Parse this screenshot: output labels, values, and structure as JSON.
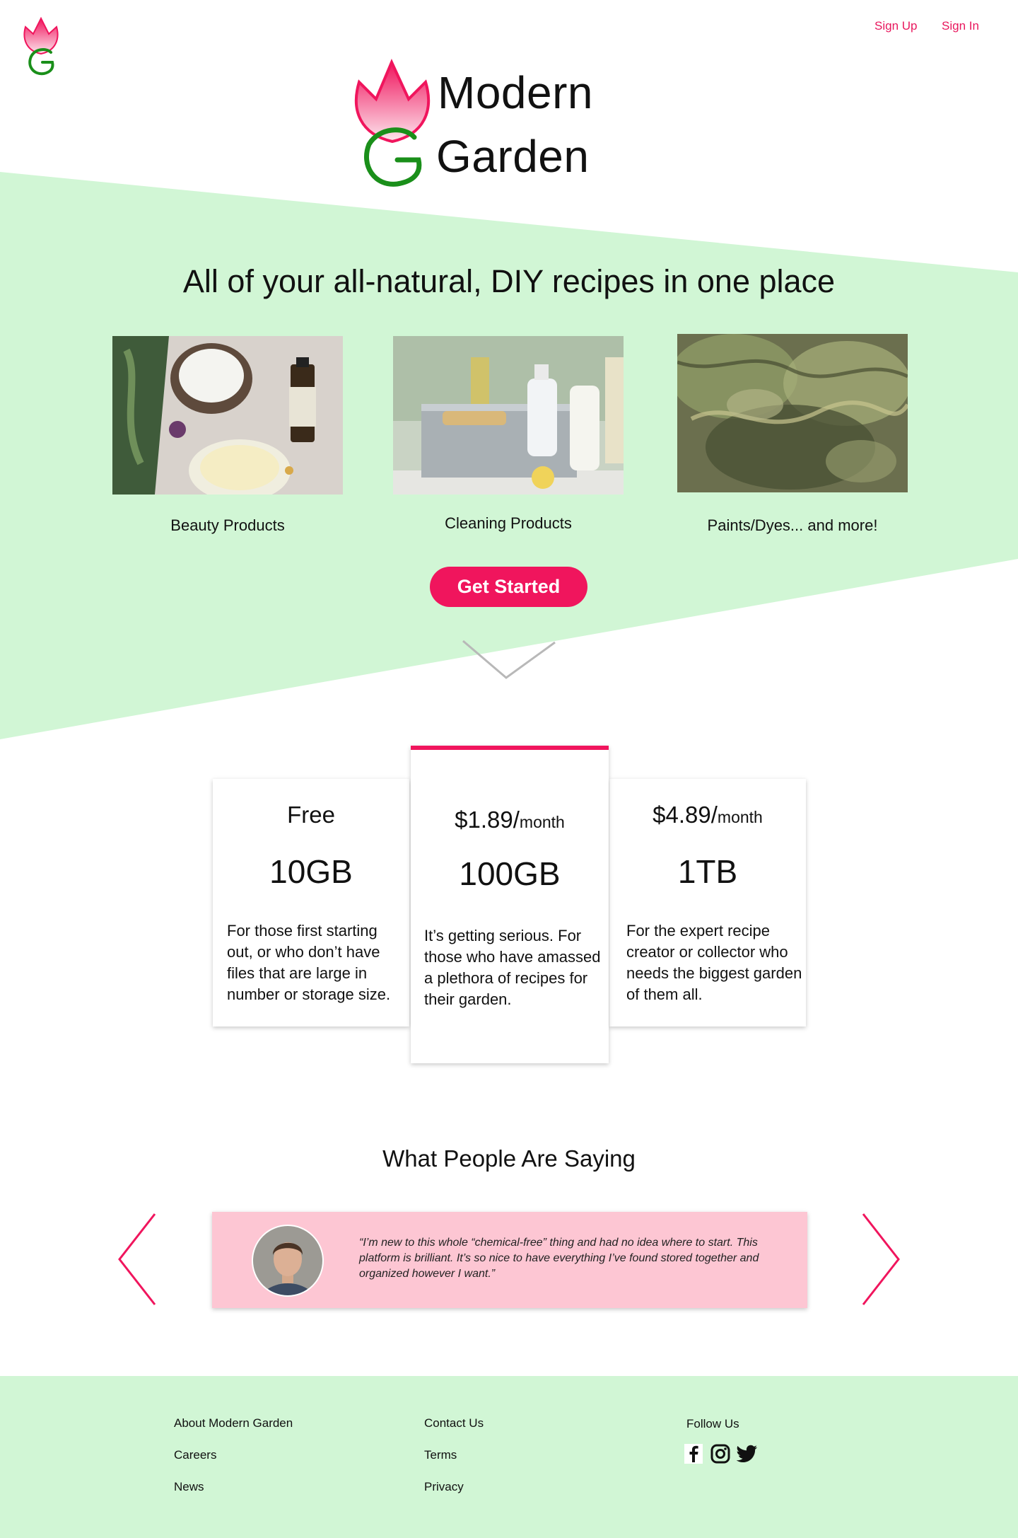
{
  "colors": {
    "accent": "#f0155d",
    "band_green": "#d1f6d5",
    "testimonial_pink": "#fdc6d3"
  },
  "nav": {
    "sign_up": "Sign Up",
    "sign_in": "Sign In"
  },
  "logo": {
    "line1": "Modern",
    "line2": "Garden"
  },
  "hero": {
    "title": "All of your all-natural, DIY recipes in one place",
    "categories": [
      {
        "label": "Beauty Products"
      },
      {
        "label": "Cleaning Products"
      },
      {
        "label": "Paints/Dyes... and more!"
      }
    ],
    "cta": "Get Started",
    "scroll_icon": "chevron-down-icon"
  },
  "pricing": {
    "plans": [
      {
        "price": "Free",
        "unit": "",
        "storage": "10GB",
        "description": "For those first starting out, or who don’t have files that are large in number or storage size.",
        "featured": false
      },
      {
        "price": "$1.89/",
        "unit": "month",
        "storage": "100GB",
        "description": "It’s getting serious. For those who have amassed a plethora of recipes for their garden.",
        "featured": true
      },
      {
        "price": "$4.89/",
        "unit": "month",
        "storage": "1TB",
        "description": "For the expert recipe creator or collector who needs the biggest garden of  them all.",
        "featured": false
      }
    ]
  },
  "testimonials": {
    "title": "What People Are Saying",
    "quote": "“I’m new to this whole “chemical-free” thing and had no idea where to start. This platform is brilliant. It’s so nice to have everything I’ve found stored together and organized however I want.”",
    "prev_icon": "chevron-left-icon",
    "next_icon": "chevron-right-icon"
  },
  "footer": {
    "col1": [
      "About Modern Garden",
      "Careers",
      "News"
    ],
    "col2": [
      "Contact Us",
      "Terms",
      "Privacy"
    ],
    "follow": "Follow Us",
    "social_icons": [
      "facebook-icon",
      "instagram-icon",
      "twitter-icon"
    ]
  }
}
